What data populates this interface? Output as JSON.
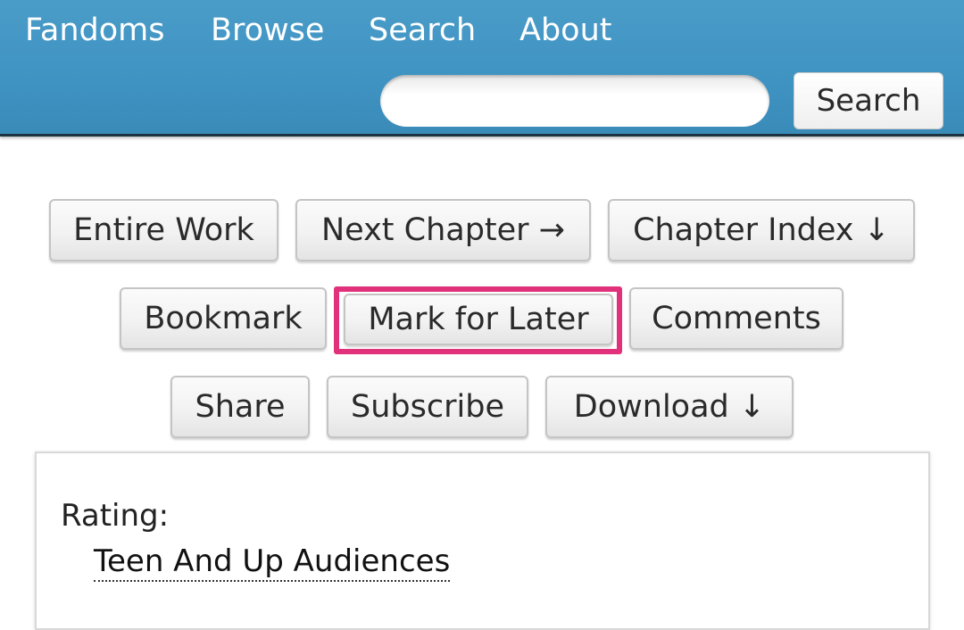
{
  "header": {
    "nav": [
      "Fandoms",
      "Browse",
      "Search",
      "About"
    ],
    "search": {
      "value": "",
      "placeholder": "",
      "button_label": "Search"
    }
  },
  "actions": {
    "entire_work": "Entire Work",
    "next_chapter": "Next Chapter →",
    "chapter_index": "Chapter Index ↓",
    "bookmark": "Bookmark",
    "mark_for_later": "Mark for Later",
    "comments": "Comments",
    "share": "Share",
    "subscribe": "Subscribe",
    "download": "Download ↓"
  },
  "meta": {
    "rating_label": "Rating:",
    "rating_value": "Teen And Up Audiences"
  },
  "colors": {
    "header": "#4197c4",
    "highlight": "#e0317a"
  }
}
